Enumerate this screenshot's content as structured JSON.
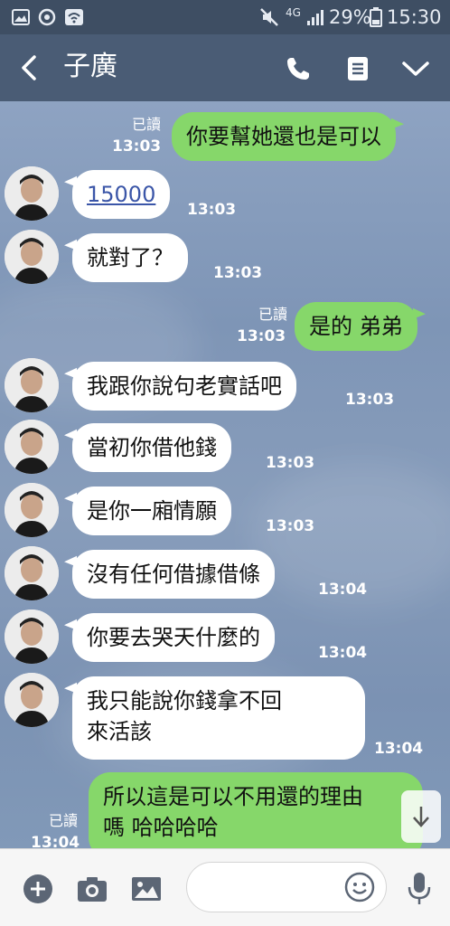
{
  "status_bar": {
    "network": "4G",
    "battery": "29%",
    "time": "15:30"
  },
  "header": {
    "title": "子廣"
  },
  "messages": [
    {
      "from": "me",
      "text": "你要幫她還也是可以",
      "time": "13:03",
      "read": "已讀"
    },
    {
      "from": "other",
      "text": "15000",
      "time": "13:03",
      "is_link": true
    },
    {
      "from": "other",
      "text": "就對了？",
      "time": "13:03"
    },
    {
      "from": "me",
      "text": "是的 弟弟",
      "time": "13:03",
      "read": "已讀"
    },
    {
      "from": "other",
      "text": "我跟你說句老實話吧",
      "time": "13:03"
    },
    {
      "from": "other",
      "text": "當初你借他錢",
      "time": "13:03"
    },
    {
      "from": "other",
      "text": "是你一廂情願",
      "time": "13:03"
    },
    {
      "from": "other",
      "text": "沒有任何借據借條",
      "time": "13:04"
    },
    {
      "from": "other",
      "text": "你要去哭天什麼的",
      "time": "13:04"
    },
    {
      "from": "other",
      "text_line1": "我只能說你錢拿不回",
      "text_line2": "來活該",
      "time": "13:04"
    },
    {
      "from": "me",
      "text_line1": "所以這是可以不用還的理由",
      "text_line2": "嗎 哈哈哈哈",
      "time": "13:04",
      "read": "已讀"
    }
  ],
  "input": {
    "placeholder": ""
  },
  "icons": {
    "back": "chevron-left-icon",
    "call": "phone-icon",
    "notes": "notes-icon",
    "menu": "chevron-down-icon",
    "add": "plus-icon",
    "camera": "camera-icon",
    "gallery": "image-icon",
    "emoji": "smiley-icon",
    "mic": "microphone-icon",
    "scroll_down": "arrow-down-icon"
  },
  "colors": {
    "header": "#4a5c75",
    "status_bar": "#3e4e63",
    "chat_bg": "#7c93b3",
    "outgoing_bubble": "#86d76a",
    "incoming_bubble": "#ffffff"
  }
}
